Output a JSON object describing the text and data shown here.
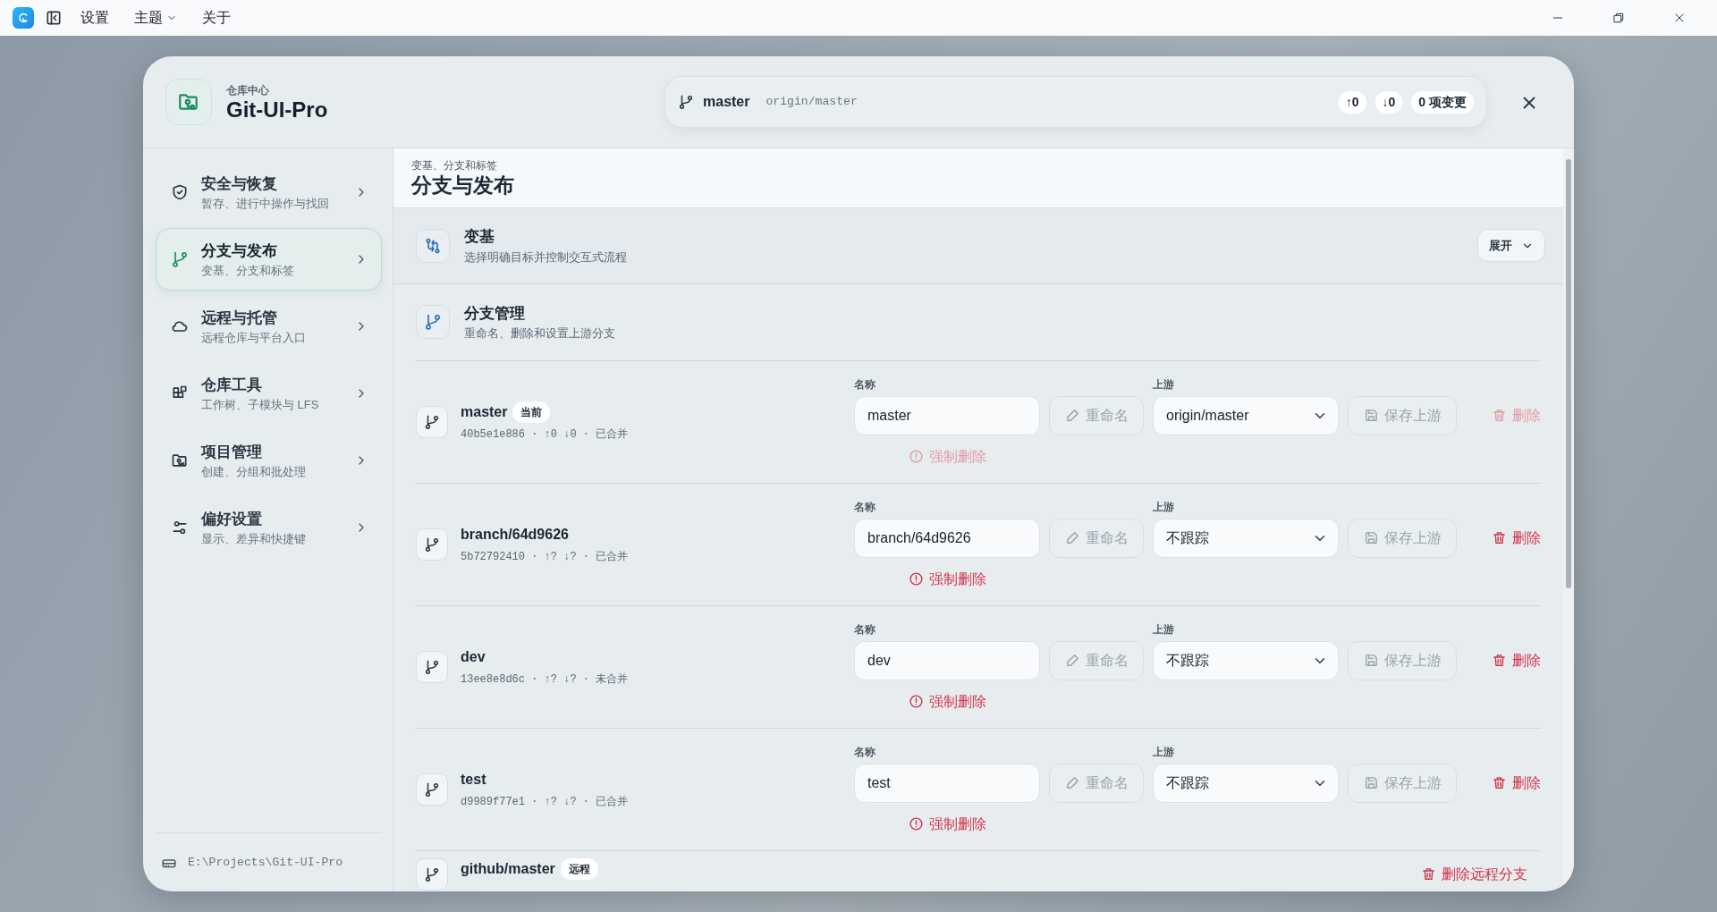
{
  "titlebar": {
    "menu": [
      {
        "label": "设置",
        "dropdown": false
      },
      {
        "label": "主题",
        "dropdown": true
      },
      {
        "label": "关于",
        "dropdown": false
      }
    ]
  },
  "dialog": {
    "subtitle": "仓库中心",
    "title": "Git-UI-Pro"
  },
  "status": {
    "branch": "master",
    "upstream": "origin/master",
    "ahead": "↑0",
    "behind": "↓0",
    "changes": "0 项变更"
  },
  "sidebar": {
    "items": [
      {
        "title": "安全与恢复",
        "subtitle": "暂存、进行中操作与找回",
        "selected": false
      },
      {
        "title": "分支与发布",
        "subtitle": "变基、分支和标签",
        "selected": true
      },
      {
        "title": "远程与托管",
        "subtitle": "远程仓库与平台入口",
        "selected": false
      },
      {
        "title": "仓库工具",
        "subtitle": "工作树、子模块与 LFS",
        "selected": false
      },
      {
        "title": "项目管理",
        "subtitle": "创建、分组和批处理",
        "selected": false
      },
      {
        "title": "偏好设置",
        "subtitle": "显示、差异和快捷键",
        "selected": false
      }
    ],
    "repo_path": "E:\\Projects\\Git-UI-Pro"
  },
  "page": {
    "subtitle": "变基、分支和标签",
    "title": "分支与发布"
  },
  "sections": [
    {
      "title": "变基",
      "subtitle": "选择明确目标并控制交互式流程",
      "expand_button": "展开"
    },
    {
      "title": "分支管理",
      "subtitle": "重命名、删除和设置上游分支"
    }
  ],
  "branches": [
    {
      "kind": "local",
      "name": "master",
      "badge": "当前",
      "meta": "40b5e1e886 · ↑0 ↓0 · 已合并",
      "name_label": "名称",
      "name_value": "master",
      "rename": "重命名",
      "rename_disabled": true,
      "upstream_label": "上游",
      "upstream_value": "origin/master",
      "save_upstream": "保存上游",
      "save_disabled": true,
      "delete": "删除",
      "delete_disabled": true,
      "force_delete": "强制删除",
      "force_disabled": true
    },
    {
      "kind": "local",
      "name": "branch/64d9626",
      "meta": "5b72792410 · ↑? ↓? · 已合并",
      "name_label": "名称",
      "name_value": "branch/64d9626",
      "rename": "重命名",
      "rename_disabled": true,
      "upstream_label": "上游",
      "upstream_value": "不跟踪",
      "save_upstream": "保存上游",
      "save_disabled": true,
      "delete": "删除",
      "delete_disabled": false,
      "force_delete": "强制删除",
      "force_disabled": false
    },
    {
      "kind": "local",
      "name": "dev",
      "meta": "13ee8e8d6c · ↑? ↓? · 未合并",
      "name_label": "名称",
      "name_value": "dev",
      "rename": "重命名",
      "rename_disabled": true,
      "upstream_label": "上游",
      "upstream_value": "不跟踪",
      "save_upstream": "保存上游",
      "save_disabled": true,
      "delete": "删除",
      "delete_disabled": false,
      "force_delete": "强制删除",
      "force_disabled": false
    },
    {
      "kind": "local",
      "name": "test",
      "meta": "d9989f77e1 · ↑? ↓? · 已合并",
      "name_label": "名称",
      "name_value": "test",
      "rename": "重命名",
      "rename_disabled": true,
      "upstream_label": "上游",
      "upstream_value": "不跟踪",
      "save_upstream": "保存上游",
      "save_disabled": true,
      "delete": "删除",
      "delete_disabled": false,
      "force_delete": "强制删除",
      "force_disabled": false
    },
    {
      "kind": "remote",
      "name": "github/master",
      "badge": "远程",
      "delete": "删除远程分支",
      "delete_disabled": false
    }
  ]
}
